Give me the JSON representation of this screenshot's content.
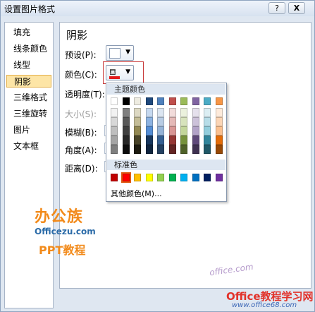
{
  "window": {
    "title": "设置图片格式",
    "help": "?",
    "close": "X"
  },
  "nav": [
    {
      "label": "填充"
    },
    {
      "label": "线条颜色"
    },
    {
      "label": "线型"
    },
    {
      "label": "阴影"
    },
    {
      "label": "三维格式"
    },
    {
      "label": "三维旋转"
    },
    {
      "label": "图片"
    },
    {
      "label": "文本框"
    }
  ],
  "shadow": {
    "section_title": "阴影",
    "preset_label": "预设(P):",
    "color_label": "颜色(C):",
    "transparency_label": "透明度(T):",
    "size_label": "大小(S):",
    "blur_label": "模糊(B):",
    "angle_label": "角度(A):",
    "distance_label": "距离(D):"
  },
  "color_popup": {
    "theme_header": "主题颜色",
    "standard_header": "标准色",
    "more_colors": "其他颜色(M)...",
    "theme_top": [
      "#ffffff",
      "#000000",
      "#eeece1",
      "#1f497d",
      "#4f81bd",
      "#c0504d",
      "#9bbb59",
      "#8064a2",
      "#4bacc6",
      "#f79646"
    ],
    "theme_shades": [
      [
        "#f2f2f2",
        "#d8d8d8",
        "#bfbfbf",
        "#a5a5a5",
        "#7f7f7f"
      ],
      [
        "#7f7f7f",
        "#595959",
        "#3f3f3f",
        "#262626",
        "#0c0c0c"
      ],
      [
        "#ddd9c3",
        "#c4bd97",
        "#938953",
        "#494429",
        "#1d1b10"
      ],
      [
        "#c6d9f0",
        "#8db3e2",
        "#548dd4",
        "#17365d",
        "#0f243e"
      ],
      [
        "#dbe5f1",
        "#b8cce4",
        "#95b3d7",
        "#366092",
        "#244061"
      ],
      [
        "#f2dcdb",
        "#e5b9b7",
        "#d99694",
        "#953734",
        "#632423"
      ],
      [
        "#ebf1dd",
        "#d7e3bc",
        "#c3d69b",
        "#76923c",
        "#4f6128"
      ],
      [
        "#e5e0ec",
        "#ccc1d9",
        "#b2a2c7",
        "#5f497a",
        "#3f3151"
      ],
      [
        "#dbeef3",
        "#b7dde8",
        "#92cddc",
        "#31859b",
        "#205867"
      ],
      [
        "#fdeada",
        "#fbd5b5",
        "#fac08f",
        "#e36c09",
        "#974806"
      ]
    ],
    "standard": [
      "#c00000",
      "#ff0000",
      "#ffc000",
      "#ffff00",
      "#92d050",
      "#00b050",
      "#00b0f0",
      "#0070c0",
      "#002060",
      "#7030a0"
    ],
    "selected_standard_index": 1
  },
  "watermark": {
    "logo_text": "办公族",
    "logo_url": "Officezu.com",
    "logo_sub": "PPT教程",
    "site_name": "Office教程学习网",
    "site_url": "www.office68.com",
    "site_small": "office.com"
  }
}
